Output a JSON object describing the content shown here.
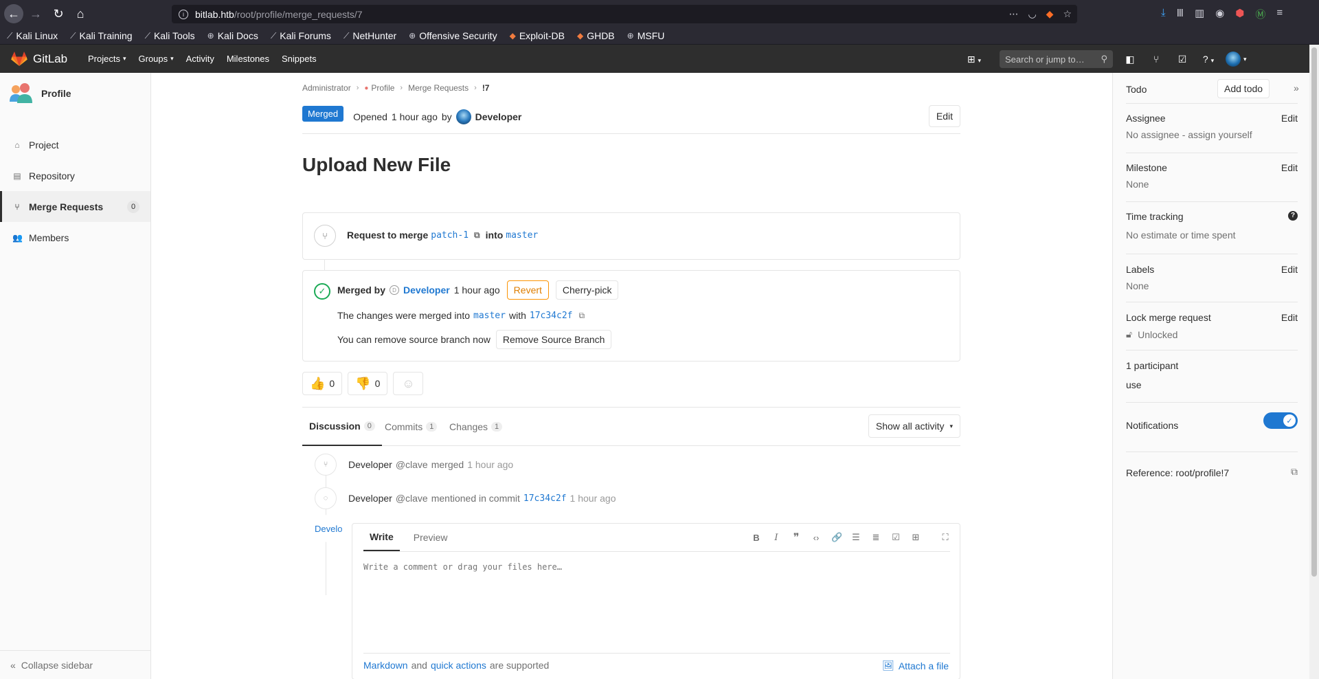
{
  "browser": {
    "url_host": "bitlab.htb",
    "url_path": "/root/profile/merge_requests/7",
    "bookmarks": [
      "Kali Linux",
      "Kali Training",
      "Kali Tools",
      "Kali Docs",
      "Kali Forums",
      "NetHunter",
      "Offensive Security",
      "Exploit-DB",
      "GHDB",
      "MSFU"
    ]
  },
  "header": {
    "brand": "GitLab",
    "nav": [
      "Projects",
      "Groups",
      "Activity",
      "Milestones",
      "Snippets"
    ],
    "search_placeholder": "Search or jump to…"
  },
  "left_sidebar": {
    "context_title": "Profile",
    "items": [
      {
        "label": "Project",
        "icon": "home-icon"
      },
      {
        "label": "Repository",
        "icon": "doc-icon"
      },
      {
        "label": "Merge Requests",
        "icon": "merge-request-icon",
        "badge": "0"
      },
      {
        "label": "Members",
        "icon": "users-icon"
      }
    ],
    "collapse_label": "Collapse sidebar"
  },
  "breadcrumb": [
    "Administrator",
    "Profile",
    "Merge Requests",
    "!7"
  ],
  "mr": {
    "status": "Merged",
    "opened_prefix": "Opened",
    "opened_time": "1 hour ago",
    "opened_by": "by",
    "author": "Developer",
    "edit_label": "Edit",
    "title": "Upload New File",
    "request_prefix": "Request to merge",
    "source_branch": "patch-1",
    "into_label": "into",
    "target_branch": "master",
    "merged_by_label": "Merged by",
    "merged_by_user": "Developer",
    "merged_time": "1 hour ago",
    "revert_label": "Revert",
    "cherry_pick_label": "Cherry-pick",
    "changes_text": "The changes were merged into",
    "with_label": "with",
    "commit_sha": "17c34c2f",
    "remove_text": "You can remove source branch now",
    "remove_btn": "Remove Source Branch",
    "thumbs_up": "0",
    "thumbs_down": "0"
  },
  "tabs": [
    {
      "label": "Discussion",
      "count": "0"
    },
    {
      "label": "Commits",
      "count": "1"
    },
    {
      "label": "Changes",
      "count": "1"
    }
  ],
  "show_activity": "Show all activity",
  "activity": [
    {
      "user": "Developer",
      "handle": "@clave",
      "action": "merged",
      "time": "1 hour ago"
    },
    {
      "user": "Developer",
      "handle": "@clave",
      "action": "mentioned in commit",
      "commit": "17c34c2f",
      "time": "1 hour ago"
    }
  ],
  "comment": {
    "avatar_text": "Develop",
    "write_tab": "Write",
    "preview_tab": "Preview",
    "placeholder": "Write a comment or drag your files here…",
    "footer_markdown": "Markdown",
    "footer_and": "and",
    "footer_quick": "quick actions",
    "footer_supported": "are supported",
    "attach": "Attach a file"
  },
  "right_sidebar": {
    "todo": "Todo",
    "add_todo": "Add todo",
    "assignee_title": "Assignee",
    "assignee_value": "No assignee - assign yourself",
    "milestone_title": "Milestone",
    "milestone_value": "None",
    "time_title": "Time tracking",
    "time_value": "No estimate or time spent",
    "labels_title": "Labels",
    "labels_value": "None",
    "lock_title": "Lock merge request",
    "lock_value": "Unlocked",
    "participants_title": "1 participant",
    "participants_value": "use",
    "notifications": "Notifications",
    "reference": "Reference: root/profile!7",
    "edit": "Edit"
  },
  "colors": {
    "merged_badge": "#1f78d1",
    "revert": "#fc9403",
    "success": "#1aaa55",
    "header_bg": "#2e2e2e"
  }
}
